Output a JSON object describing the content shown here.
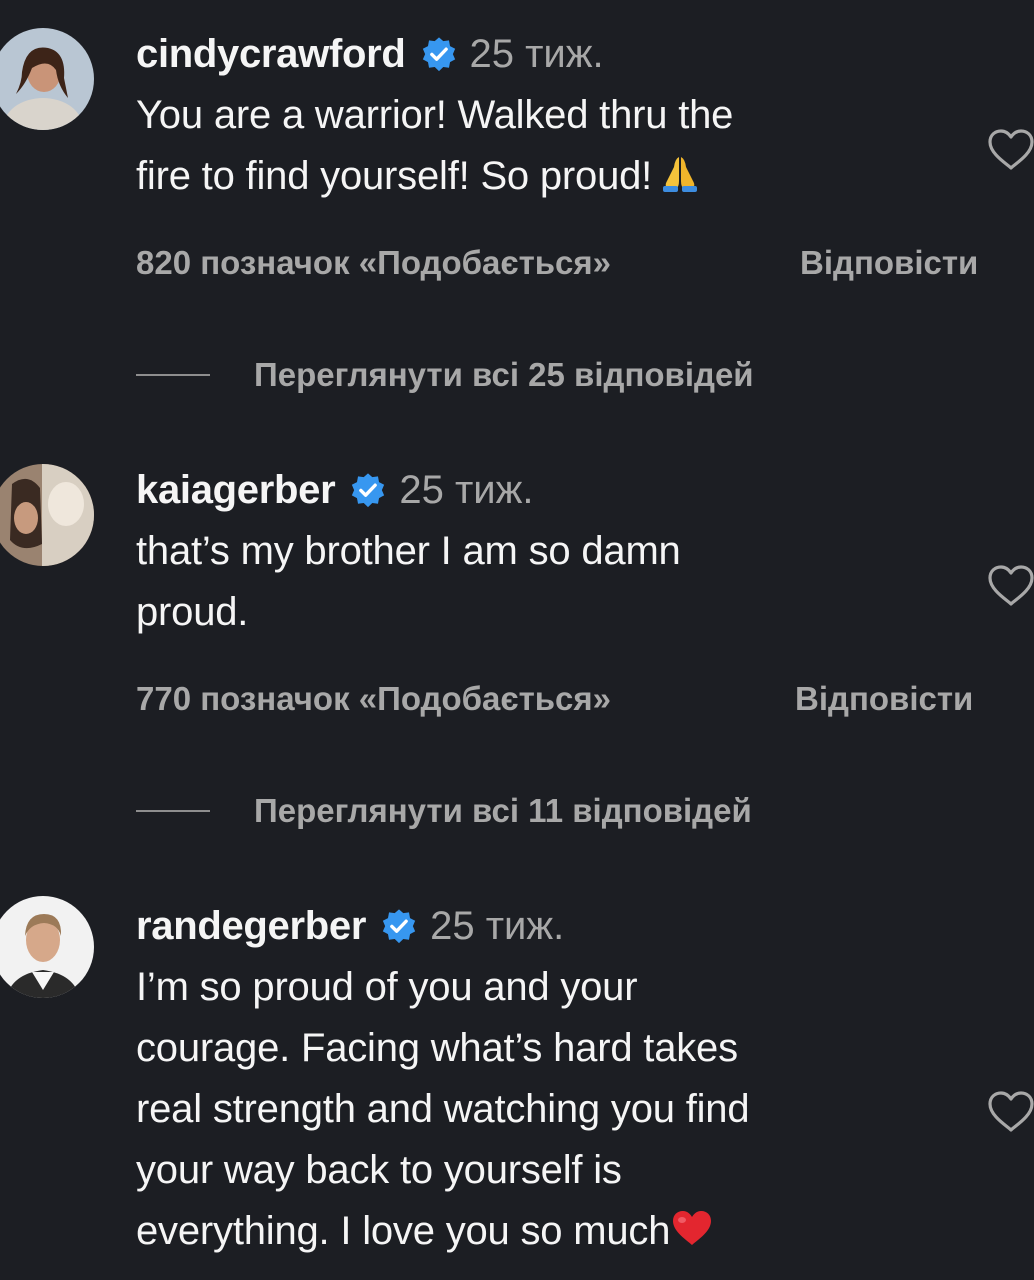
{
  "comments": [
    {
      "username": "cindycrawford",
      "time": "25 тиж.",
      "lines": [
        "You are a warrior! Walked thru the",
        "fire to find yourself! So proud!"
      ],
      "emoji": "folded-hands",
      "likes": "820 позначок «Подобається»",
      "reply": "Відповісти",
      "view_replies": "Переглянути всі 25 відповідей"
    },
    {
      "username": "kaiagerber",
      "time": "25 тиж.",
      "lines": [
        "that’s my brother I am so damn",
        "proud."
      ],
      "likes": "770 позначок «Подобається»",
      "reply": "Відповісти",
      "view_replies": "Переглянути всі 11 відповідей"
    },
    {
      "username": "randegerber",
      "time": "25 тиж.",
      "lines": [
        "I’m so proud of you and your",
        "courage. Facing what’s hard takes",
        "real strength and watching you find",
        "your way back to yourself is",
        "everything. I love you so much"
      ],
      "emoji": "red-heart"
    }
  ],
  "colors": {
    "background": "#1c1e23",
    "text": "#f5f5f5",
    "secondary": "#a8a8a8",
    "verified": "#3797f0"
  }
}
